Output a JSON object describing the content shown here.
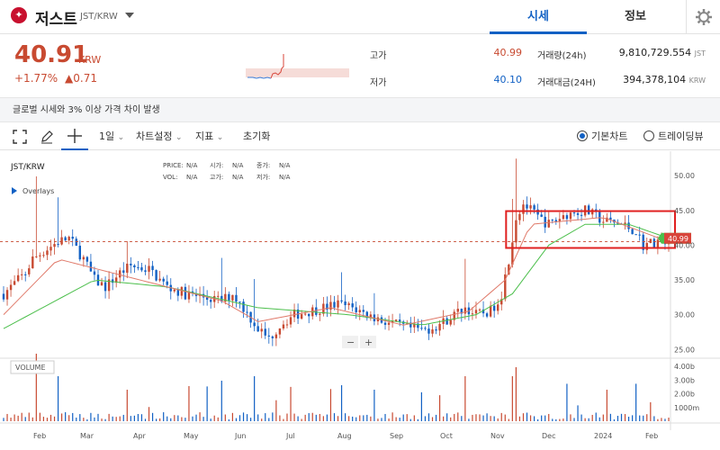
{
  "header": {
    "coin_name": "저스트",
    "pair": "JST/KRW",
    "tabs": [
      {
        "label": "시세"
      },
      {
        "label": "정보"
      }
    ]
  },
  "summary": {
    "price": "40.91",
    "unit": "KRW",
    "change_percent": "+1.77%",
    "change_amount": "▲0.71",
    "high_label": "고가",
    "high_value": "40.99",
    "low_label": "저가",
    "low_value": "40.10",
    "volume_label": "거래량(24h)",
    "volume_value": "9,810,729.554",
    "volume_unit": "JST",
    "turnover_label": "거래대금(24H)",
    "turnover_value": "394,378,104",
    "turnover_unit": "KRW"
  },
  "notice": "글로벌 시세와 3% 이상 가격 차이 발생",
  "toolbar": {
    "interval": "1일",
    "chart_settings": "차트설정",
    "indicators": "지표",
    "reset": "초기화",
    "view_basic": "기본차트",
    "view_trading": "트레이딩뷰"
  },
  "chart": {
    "pair": "JST/KRW",
    "overlays": "Overlays",
    "legend": {
      "price_l": "PRICE:",
      "price_v": "N/A",
      "open_l": "시가:",
      "open_v": "N/A",
      "close_l": "종가:",
      "close_v": "N/A",
      "vol_l": "VOL:",
      "vol_v": "N/A",
      "high_l": "고가:",
      "high_v": "N/A",
      "low_l": "저가:",
      "low_v": "N/A"
    },
    "price_label": "40.99",
    "volume_title": "VOLUME",
    "zoom_out": "−",
    "zoom_in": "+"
  },
  "chart_data": {
    "type": "candlestick",
    "x_labels": [
      "Feb",
      "Mar",
      "Apr",
      "May",
      "Jun",
      "Jul",
      "Aug",
      "Sep",
      "Oct",
      "Nov",
      "Dec",
      "2024",
      "Feb"
    ],
    "y_ticks": [
      "50.00",
      "45.00",
      "40.00",
      "35.00",
      "30.00",
      "25.00"
    ],
    "volume_ticks": [
      "4.00b",
      "3.00b",
      "2.00b",
      "1000m"
    ],
    "ylim": [
      24,
      53
    ],
    "price_path": [
      [
        0,
        33
      ],
      [
        6,
        36
      ],
      [
        8,
        38
      ],
      [
        12,
        39.5
      ],
      [
        15,
        40.5
      ],
      [
        18,
        41
      ],
      [
        22,
        38
      ],
      [
        25,
        35
      ],
      [
        28,
        34
      ],
      [
        32,
        36
      ],
      [
        35,
        37
      ],
      [
        40,
        36.5
      ],
      [
        45,
        34
      ],
      [
        50,
        33
      ],
      [
        55,
        32.5
      ],
      [
        60,
        32
      ],
      [
        63,
        33
      ],
      [
        66,
        31
      ],
      [
        70,
        28
      ],
      [
        73,
        26.5
      ],
      [
        76,
        28.5
      ],
      [
        80,
        30
      ],
      [
        84,
        30.5
      ],
      [
        88,
        31
      ],
      [
        92,
        31.5
      ],
      [
        96,
        31
      ],
      [
        100,
        30
      ],
      [
        104,
        29.2
      ],
      [
        108,
        28.5
      ],
      [
        112,
        28
      ],
      [
        116,
        27.8
      ],
      [
        120,
        28.6
      ],
      [
        124,
        30
      ],
      [
        127,
        31
      ],
      [
        130,
        30
      ],
      [
        134,
        30.5
      ],
      [
        137,
        33
      ],
      [
        139,
        38
      ],
      [
        141,
        44
      ],
      [
        143,
        46
      ],
      [
        147,
        44
      ],
      [
        150,
        43
      ],
      [
        155,
        44.5
      ],
      [
        160,
        45
      ],
      [
        165,
        43.5
      ],
      [
        170,
        43
      ],
      [
        174,
        42
      ],
      [
        176,
        40
      ],
      [
        179,
        40.5
      ],
      [
        183,
        40.9
      ]
    ],
    "ma_fast": [
      [
        0,
        30
      ],
      [
        15,
        38
      ],
      [
        30,
        36
      ],
      [
        60,
        32
      ],
      [
        70,
        29
      ],
      [
        90,
        31
      ],
      [
        110,
        28.5
      ],
      [
        128,
        30.5
      ],
      [
        138,
        35
      ],
      [
        145,
        43
      ],
      [
        165,
        44
      ],
      [
        183,
        40.5
      ]
    ],
    "ma_slow": [
      [
        0,
        28
      ],
      [
        25,
        35
      ],
      [
        45,
        34
      ],
      [
        70,
        31
      ],
      [
        95,
        30
      ],
      [
        115,
        28.5
      ],
      [
        130,
        30
      ],
      [
        140,
        33
      ],
      [
        150,
        40
      ],
      [
        160,
        43
      ],
      [
        172,
        43
      ],
      [
        183,
        41
      ]
    ],
    "last_price": 40.99,
    "dashed_reference": 40.5,
    "highlight_range": {
      "x_from": 139,
      "x_to": 183,
      "y_from": 39.6,
      "y_to": 44.9
    }
  },
  "colors": {
    "up": "#c84a31",
    "down": "#1261c4",
    "accent": "#1261c4",
    "ma_fast": "#e07a6a",
    "ma_slow": "#4cbf4c",
    "highlight": "#e02020"
  }
}
